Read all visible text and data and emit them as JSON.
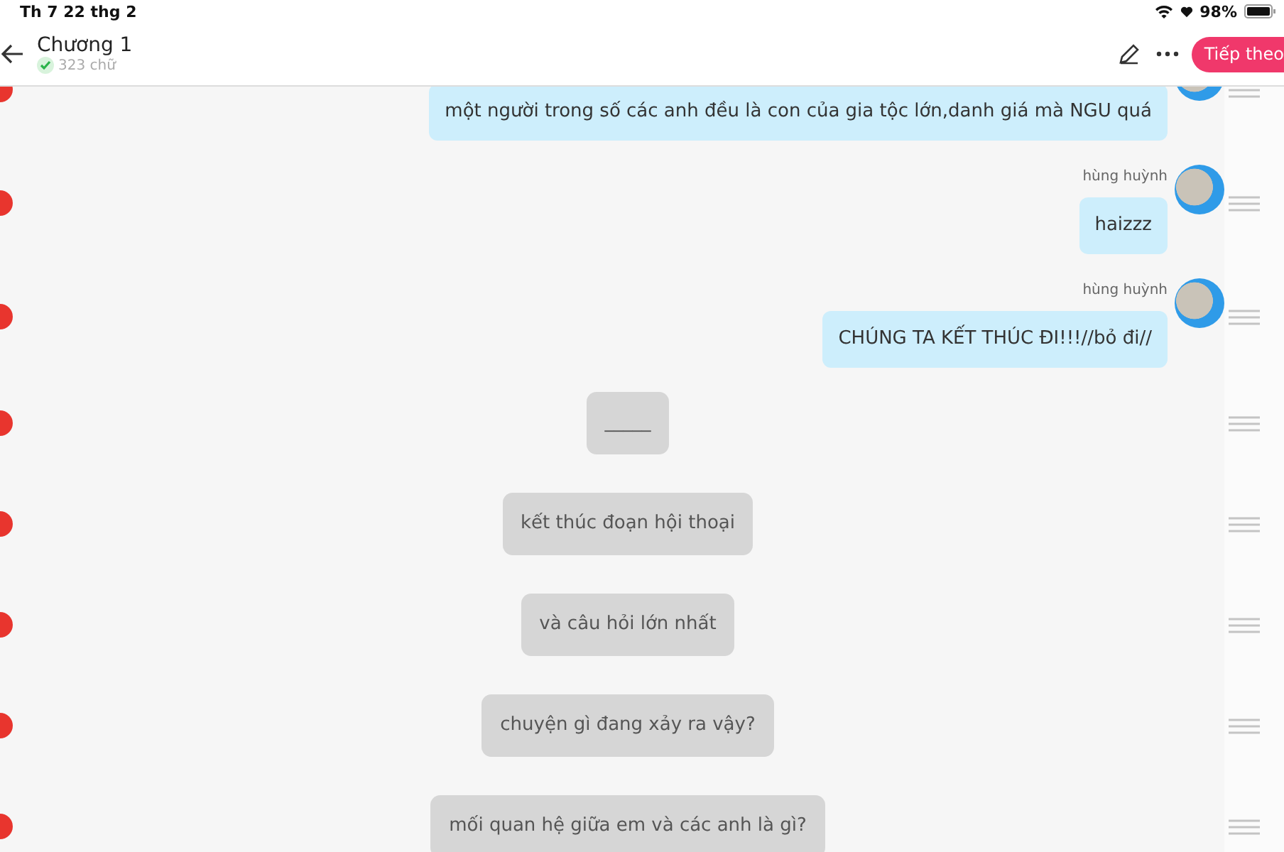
{
  "status_bar": {
    "date": "Th 7 22 thg 2",
    "battery": "98%"
  },
  "header": {
    "title": "Chương 1",
    "word_count": "323 chữ",
    "saved": true,
    "next_button": "Tiếp theo"
  },
  "messages": [
    {
      "kind": "user",
      "text": "một người trong số các anh đều là con của gia tộc lớn,danh giá mà NGU quá"
    },
    {
      "kind": "user",
      "name": "hùng huỳnh",
      "text": "haizzz"
    },
    {
      "kind": "user",
      "name": "hùng huỳnh",
      "text": "CHÚNG TA KẾT THÚC ĐI!!!//bỏ đi//"
    },
    {
      "kind": "narrator",
      "text": "_____"
    },
    {
      "kind": "narrator",
      "text": "kết thúc đoạn hội thoại"
    },
    {
      "kind": "narrator",
      "text": "và câu hỏi lớn nhất"
    },
    {
      "kind": "narrator",
      "text": "chuyện gì đang xảy ra vậy?"
    },
    {
      "kind": "narrator",
      "text": "mối quan hệ giữa em và các anh là gì?"
    }
  ]
}
